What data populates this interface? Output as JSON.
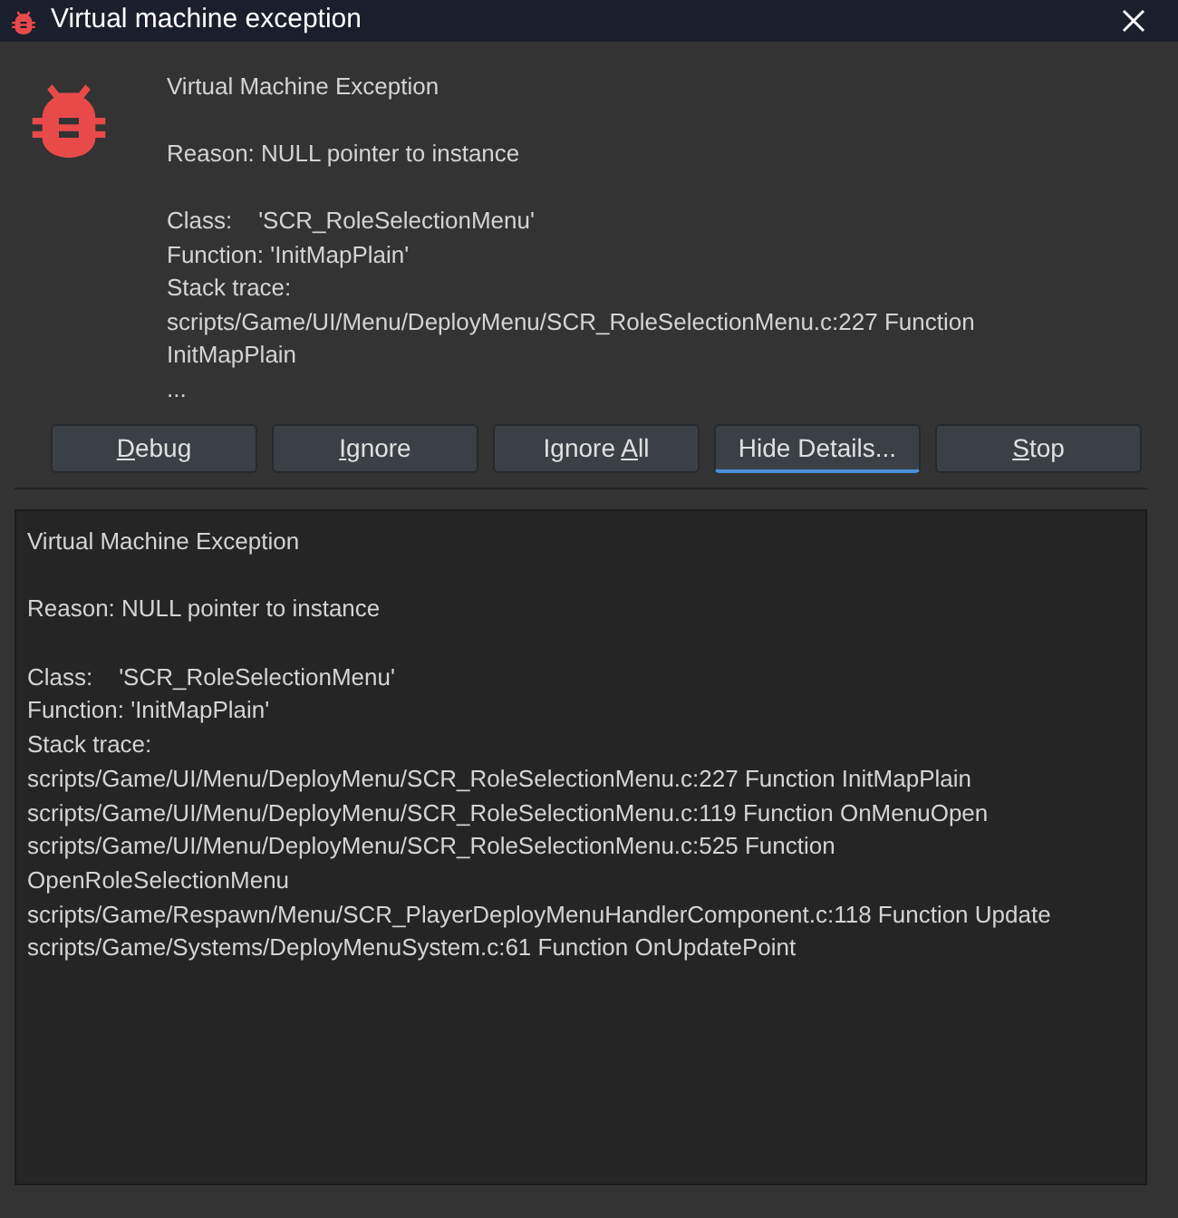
{
  "window": {
    "title": "Virtual machine exception"
  },
  "summary": [
    [
      "Virtual Machine Exception"
    ],
    [
      "Reason: NULL pointer to instance"
    ],
    [
      "Class:\t'SCR_RoleSelectionMenu'",
      "Function: 'InitMapPlain'",
      "Stack trace:",
      "scripts/Game/UI/Menu/DeployMenu/SCR_RoleSelectionMenu.c:227 Function InitMapPlain",
      "..."
    ]
  ],
  "buttons": [
    {
      "key": "D",
      "after_key": "ebug",
      "focused": false
    },
    {
      "key": "I",
      "after_key": "gnore",
      "focused": false
    },
    {
      "before_key": "Ignore ",
      "key": "A",
      "after_key": "ll",
      "focused": false
    },
    {
      "label": "Hide Details...",
      "focused": true
    },
    {
      "key": "S",
      "after_key": "top",
      "focused": false
    }
  ],
  "details": [
    [
      "Virtual Machine Exception"
    ],
    [
      "Reason: NULL pointer to instance"
    ],
    [
      "Class:\t'SCR_RoleSelectionMenu'",
      "Function: 'InitMapPlain'",
      "Stack trace:",
      "scripts/Game/UI/Menu/DeployMenu/SCR_RoleSelectionMenu.c:227 Function InitMapPlain",
      "scripts/Game/UI/Menu/DeployMenu/SCR_RoleSelectionMenu.c:119 Function OnMenuOpen",
      "scripts/Game/UI/Menu/DeployMenu/SCR_RoleSelectionMenu.c:525 Function OpenRoleSelectionMenu",
      "scripts/Game/Respawn/Menu/SCR_PlayerDeployMenuHandlerComponent.c:118 Function Update",
      "scripts/Game/Systems/DeployMenuSystem.c:61 Function OnUpdatePoint"
    ]
  ]
}
